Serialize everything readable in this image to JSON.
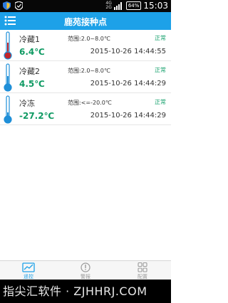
{
  "status_bar": {
    "network_top": "4G",
    "network_bottom": "2G",
    "battery": "64%",
    "time": "15:03"
  },
  "header": {
    "title": "鹿苑接种点"
  },
  "rows": [
    {
      "name": "冷藏1",
      "temperature": "6.4℃",
      "range": "范围:2.0~8.0℃",
      "status": "正常",
      "time": "2015-10-26 14:44:55"
    },
    {
      "name": "冷藏2",
      "temperature": "4.5℃",
      "range": "范围:2.0~8.0℃",
      "status": "正常",
      "time": "2015-10-26 14:44:29"
    },
    {
      "name": "冷冻",
      "temperature": "-27.2℃",
      "range": "范围:<=-20.0℃",
      "status": "正常",
      "time": "2015-10-26 14:44:29"
    }
  ],
  "tabs": [
    {
      "label": "遥控",
      "icon": "monitor-chart-icon",
      "active": true
    },
    {
      "label": "警报",
      "icon": "alarm-icon",
      "active": false
    },
    {
      "label": "配置",
      "icon": "grid-config-icon",
      "active": false
    }
  ],
  "watermark": "指尖汇软件 · ZJHHRJ.COM",
  "colors": {
    "header": "#1da1e8",
    "value_green": "#0f9a63",
    "thermo_red": "#c0262b",
    "thermo_blue": "#1f8fd8"
  }
}
